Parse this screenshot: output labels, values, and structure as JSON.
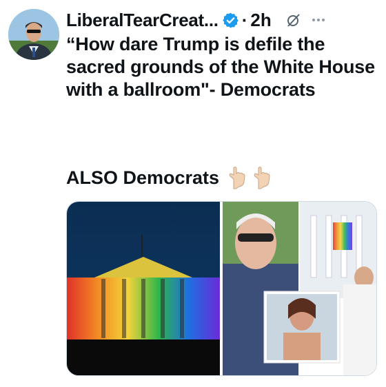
{
  "post": {
    "author_name": "LiberalTearCreat...",
    "separator": "·",
    "time": "2h",
    "text": "“How dare Trump is defile the sacred grounds of the White House with a ballroom\"- Democrats",
    "second_line": "ALSO Democrats"
  },
  "icons": {
    "verified": "verified-badge-icon",
    "grok": "grok-icon",
    "more": "more-icon",
    "pointing": "pointing-down-hand-icon"
  },
  "colors": {
    "verified_blue": "#1d9bf0",
    "text": "#0f1419"
  }
}
